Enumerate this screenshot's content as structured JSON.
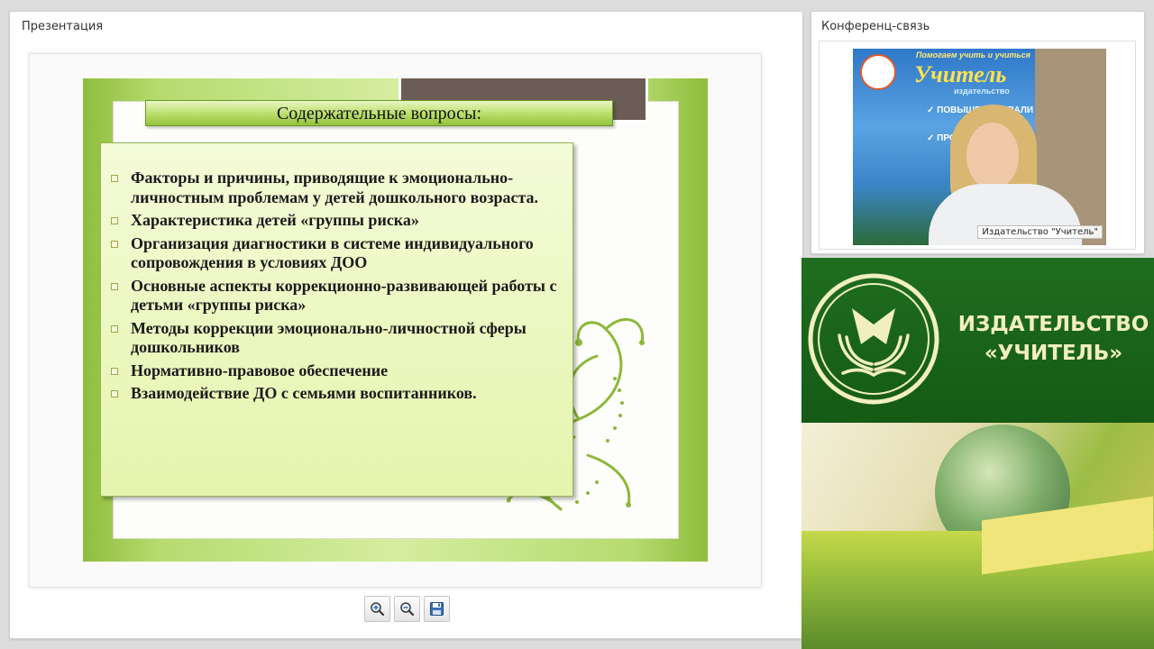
{
  "presentation": {
    "title": "Презентация",
    "slide": {
      "heading": "Содержательные вопросы:",
      "bullets": [
        "Факторы и причины, приводящие  к эмоционально-личностным проблемам у детей дошкольного возраста.",
        "Характеристика детей «группы риска»",
        "Организация диагностики в системе индивидуального сопровождения в условиях ДОО",
        "Основные аспекты коррекционно-развивающей работы с детьми «группы риска»",
        "Методы коррекции эмоционально-личностной сферы дошкольников",
        "Нормативно-правовое обеспечение",
        "Взаимодействие ДО с семьями воспитанников."
      ],
      "colors": {
        "frame": "#a6cf5a",
        "title_bar": "#b9dd69",
        "content_box": "#eaf6b8",
        "tab": "#6b5d55",
        "flourish": "#8db83a"
      }
    },
    "toolbar": [
      {
        "icon": "zoom-in-icon"
      },
      {
        "icon": "zoom-out-icon"
      },
      {
        "icon": "save-icon"
      }
    ]
  },
  "conference": {
    "title": "Конференц-связь",
    "video_label": "Издательство \"Учитель\"",
    "banner_text_1": "Помогаем учить и учиться",
    "banner_text_2": "Учитель",
    "banner_text_3": "издательство",
    "banner_text_4": "✓ ПОВЫШЕНИЕ КВАЛИФ",
    "banner_text_5": "✓ ПРОФЕ"
  },
  "branding": {
    "line1": "ИЗДАТЕЛЬСТВО",
    "line2": "«УЧИТЕЛЬ»",
    "colors": {
      "green": "#1b661b",
      "text": "#f1efc0"
    }
  }
}
